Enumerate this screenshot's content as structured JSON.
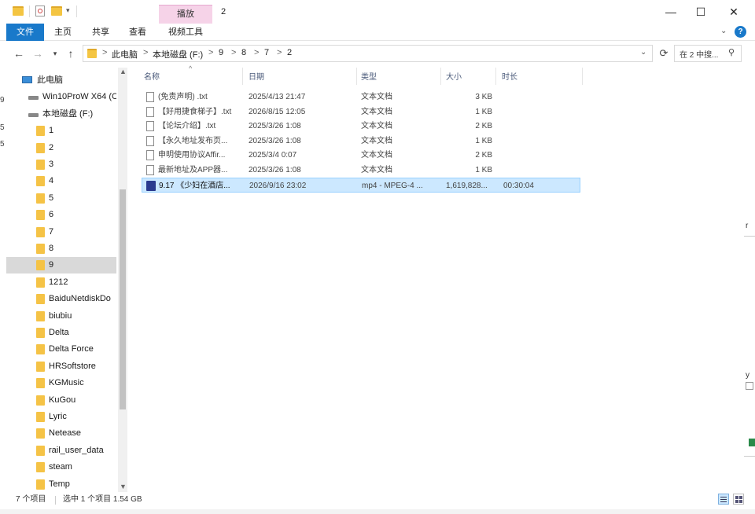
{
  "window": {
    "title": "2",
    "controls": {
      "minimize": "—",
      "maximize": "☐",
      "close": "✕"
    }
  },
  "ribbon": {
    "context_group": "播放",
    "tabs": [
      {
        "label": "文件"
      },
      {
        "label": "主页"
      },
      {
        "label": "共享"
      },
      {
        "label": "查看"
      },
      {
        "label": "视频工具"
      }
    ]
  },
  "address": {
    "crumbs": [
      "此电脑",
      "本地磁盘 (F:)",
      "9",
      "8",
      "7",
      "2"
    ],
    "search_placeholder": "在 2 中搜..."
  },
  "nav": {
    "items": [
      {
        "label": "此电脑",
        "type": "pc"
      },
      {
        "label": "Win10ProW X64 (C",
        "type": "drive"
      },
      {
        "label": "本地磁盘 (F:)",
        "type": "drive"
      },
      {
        "label": "1",
        "type": "folder"
      },
      {
        "label": "2",
        "type": "folder"
      },
      {
        "label": "3",
        "type": "folder"
      },
      {
        "label": "4",
        "type": "folder"
      },
      {
        "label": "5",
        "type": "folder"
      },
      {
        "label": "6",
        "type": "folder"
      },
      {
        "label": "7",
        "type": "folder"
      },
      {
        "label": "8",
        "type": "folder"
      },
      {
        "label": "9",
        "type": "folder",
        "selected": true
      },
      {
        "label": "1212",
        "type": "folder"
      },
      {
        "label": "BaiduNetdiskDo",
        "type": "folder"
      },
      {
        "label": "biubiu",
        "type": "folder"
      },
      {
        "label": "Delta",
        "type": "folder"
      },
      {
        "label": "Delta Force",
        "type": "folder"
      },
      {
        "label": "HRSoftstore",
        "type": "folder"
      },
      {
        "label": "KGMusic",
        "type": "folder"
      },
      {
        "label": "KuGou",
        "type": "folder"
      },
      {
        "label": "Lyric",
        "type": "folder"
      },
      {
        "label": "Netease",
        "type": "folder"
      },
      {
        "label": "rail_user_data",
        "type": "folder"
      },
      {
        "label": "steam",
        "type": "folder"
      },
      {
        "label": "Temp",
        "type": "folder"
      }
    ]
  },
  "columns": {
    "name": "名称",
    "date": "日期",
    "type": "类型",
    "size": "大小",
    "duration": "时长"
  },
  "files": [
    {
      "name": "(免责声明) .txt",
      "date": "2025/4/13 21:47",
      "type": "文本文档",
      "size": "3 KB",
      "duration": "",
      "kind": "txt"
    },
    {
      "name": "【好用捷食梯子】.txt",
      "date": "2026/8/15 12:05",
      "type": "文本文档",
      "size": "1 KB",
      "duration": "",
      "kind": "txt"
    },
    {
      "name": "【论坛介绍】.txt",
      "date": "2025/3/26 1:08",
      "type": "文本文档",
      "size": "2 KB",
      "duration": "",
      "kind": "txt"
    },
    {
      "name": "【永久地址发布页...",
      "date": "2025/3/26 1:08",
      "type": "文本文档",
      "size": "1 KB",
      "duration": "",
      "kind": "txt"
    },
    {
      "name": "申明使用协议Affir...",
      "date": "2025/3/4 0:07",
      "type": "文本文档",
      "size": "2 KB",
      "duration": "",
      "kind": "txt"
    },
    {
      "name": "最新地址及APP器...",
      "date": "2025/3/26 1:08",
      "type": "文本文档",
      "size": "1 KB",
      "duration": "",
      "kind": "txt"
    },
    {
      "name": "9.17 《少妇在酒店...",
      "date": "2026/9/16 23:02",
      "type": "mp4 - MPEG-4 ...",
      "size": "1,619,828...",
      "duration": "00:30:04",
      "kind": "mp4",
      "selected": true
    }
  ],
  "status": {
    "count": "7 个项目",
    "selection": "选中 1 个项目  1.54 GB"
  }
}
